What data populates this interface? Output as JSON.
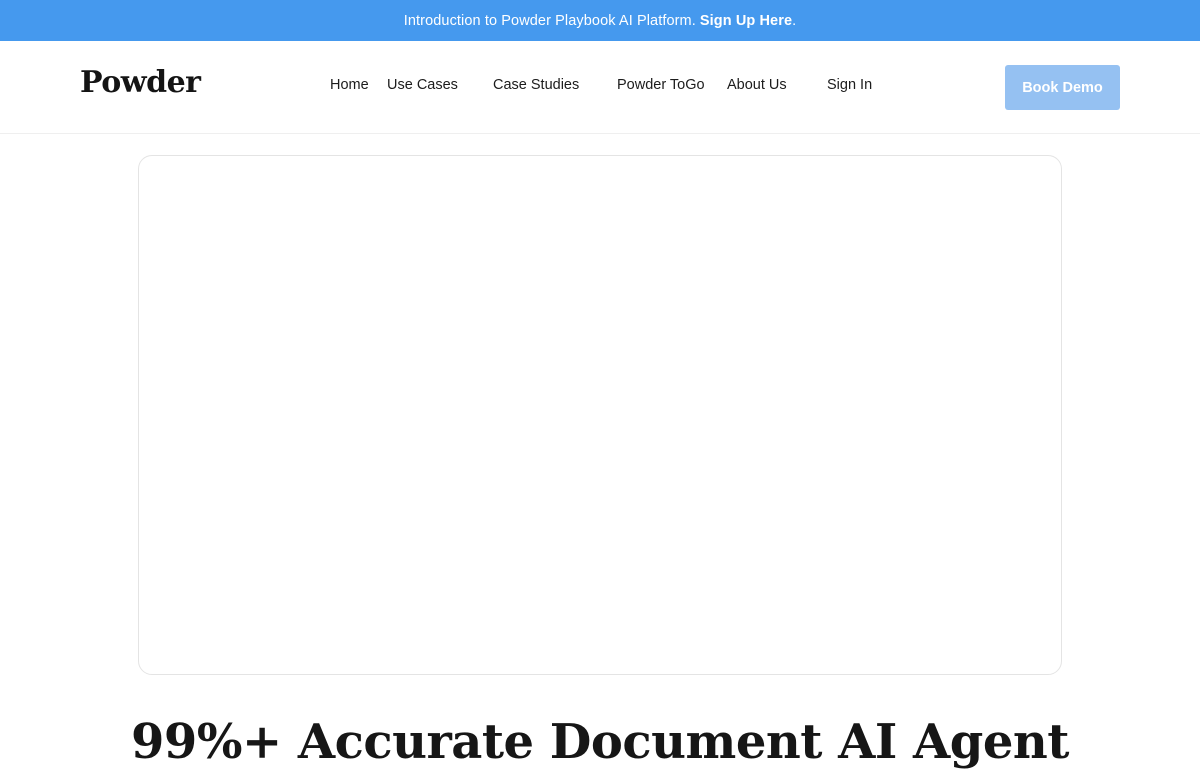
{
  "announcement": {
    "text": "Introduction to Powder Playbook AI Platform.",
    "cta": "Sign Up Here",
    "trailing": "."
  },
  "header": {
    "logo": "Powder",
    "nav": [
      "Home",
      "Use Cases",
      "Case Studies",
      "Powder ToGo",
      "About Us",
      "Sign In"
    ],
    "book_demo": "Book Demo"
  },
  "hero": {
    "title": "99%+ Accurate Document AI Agent"
  },
  "colors": {
    "announcement_bg": "#4599ee",
    "book_demo_bg": "#95c1f2"
  }
}
